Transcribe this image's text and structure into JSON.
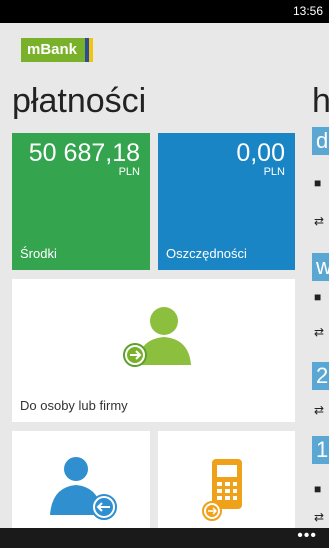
{
  "status": {
    "time": "13:56"
  },
  "brand": {
    "logo": "mBank"
  },
  "page": {
    "title": "płatności",
    "next_title": "h"
  },
  "tiles": {
    "srodki": {
      "amount": "50 687,18",
      "currency": "PLN",
      "label": "Środki"
    },
    "oszczednosci": {
      "amount": "0,00",
      "currency": "PLN",
      "label": "Oszczędności"
    },
    "person": {
      "label": "Do osoby lub firmy"
    }
  },
  "history_peek": [
    {
      "letter": "d"
    },
    {
      "letter": "w"
    },
    {
      "letter": "2"
    },
    {
      "letter": "1"
    }
  ],
  "appbar": {
    "more": "•••"
  },
  "colors": {
    "green": "#34a54e",
    "blue": "#1a85c4",
    "accent_green": "#79b12a"
  }
}
